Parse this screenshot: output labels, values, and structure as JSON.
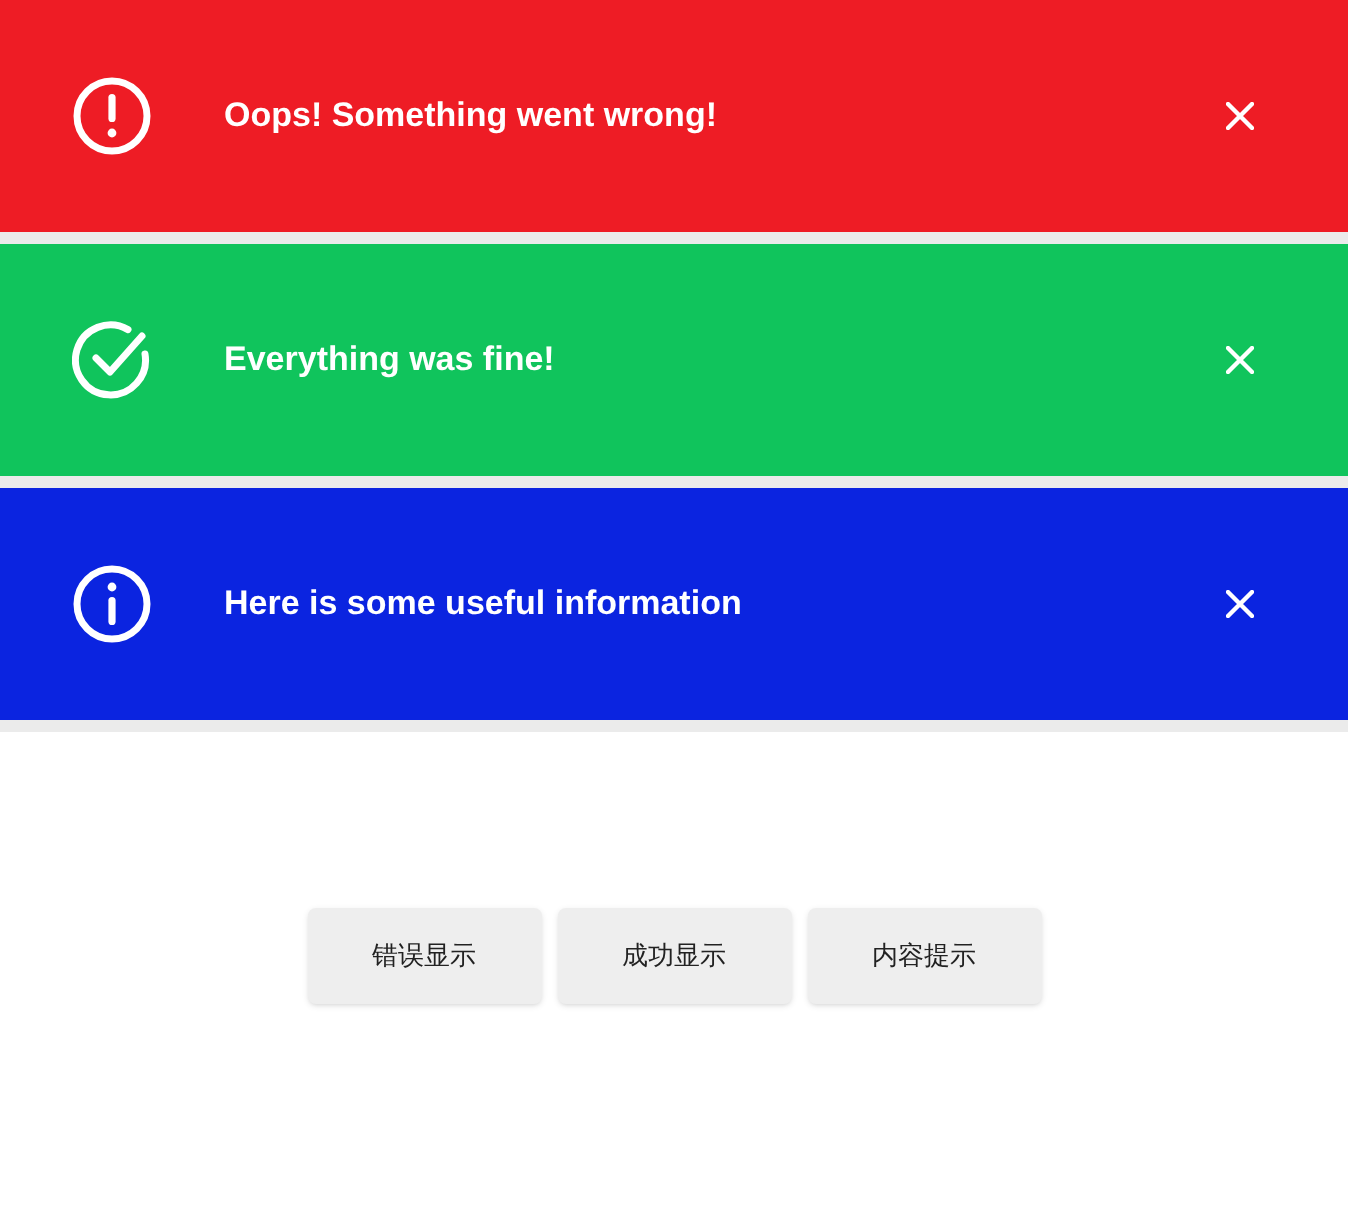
{
  "alerts": [
    {
      "kind": "error",
      "message": "Oops! Something went wrong!"
    },
    {
      "kind": "success",
      "message": "Everything was fine!"
    },
    {
      "kind": "info",
      "message": "Here is some useful information"
    }
  ],
  "buttons": [
    "错误显示",
    "成功显示",
    "内容提示"
  ]
}
